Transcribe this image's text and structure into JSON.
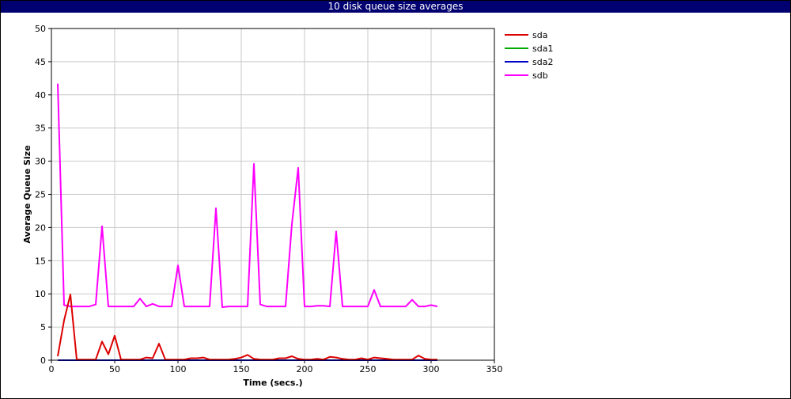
{
  "window": {
    "title": "10 disk queue size averages"
  },
  "chart_data": {
    "type": "line",
    "title": "10 disk queue size averages",
    "xlabel": "Time (secs.)",
    "ylabel": "Average Queue Size",
    "xlim": [
      0,
      350
    ],
    "ylim": [
      0,
      50
    ],
    "xticks": [
      0,
      50,
      100,
      150,
      200,
      250,
      300,
      350
    ],
    "yticks": [
      0,
      5,
      10,
      15,
      20,
      25,
      30,
      35,
      40,
      45,
      50
    ],
    "grid": true,
    "legend_position": "right",
    "series": [
      {
        "name": "sda",
        "color": "#dd0000",
        "points": [
          [
            5,
            0.6
          ],
          [
            10,
            6
          ],
          [
            15,
            9.9
          ],
          [
            20,
            0.1
          ],
          [
            25,
            0.1
          ],
          [
            30,
            0.1
          ],
          [
            35,
            0.1
          ],
          [
            40,
            2.8
          ],
          [
            45,
            0.9
          ],
          [
            50,
            3.7
          ],
          [
            55,
            0.1
          ],
          [
            60,
            0.1
          ],
          [
            65,
            0.1
          ],
          [
            70,
            0.1
          ],
          [
            75,
            0.4
          ],
          [
            80,
            0.3
          ],
          [
            85,
            2.5
          ],
          [
            90,
            0.1
          ],
          [
            95,
            0.1
          ],
          [
            100,
            0.1
          ],
          [
            105,
            0.1
          ],
          [
            110,
            0.3
          ],
          [
            115,
            0.3
          ],
          [
            120,
            0.4
          ],
          [
            125,
            0.1
          ],
          [
            130,
            0.1
          ],
          [
            135,
            0.1
          ],
          [
            140,
            0.1
          ],
          [
            145,
            0.2
          ],
          [
            150,
            0.4
          ],
          [
            155,
            0.8
          ],
          [
            160,
            0.2
          ],
          [
            165,
            0.1
          ],
          [
            170,
            0.1
          ],
          [
            175,
            0.1
          ],
          [
            180,
            0.3
          ],
          [
            185,
            0.3
          ],
          [
            190,
            0.6
          ],
          [
            195,
            0.2
          ],
          [
            200,
            0.1
          ],
          [
            205,
            0.1
          ],
          [
            210,
            0.2
          ],
          [
            215,
            0.1
          ],
          [
            220,
            0.5
          ],
          [
            225,
            0.4
          ],
          [
            230,
            0.2
          ],
          [
            235,
            0.1
          ],
          [
            240,
            0.1
          ],
          [
            245,
            0.3
          ],
          [
            250,
            0.1
          ],
          [
            255,
            0.4
          ],
          [
            260,
            0.3
          ],
          [
            265,
            0.2
          ],
          [
            270,
            0.1
          ],
          [
            275,
            0.1
          ],
          [
            280,
            0.1
          ],
          [
            285,
            0.1
          ],
          [
            290,
            0.7
          ],
          [
            295,
            0.2
          ],
          [
            300,
            0.1
          ],
          [
            305,
            0.1
          ]
        ]
      },
      {
        "name": "sda1",
        "color": "#00aa00",
        "points": [
          [
            5,
            0
          ],
          [
            305,
            0
          ]
        ]
      },
      {
        "name": "sda2",
        "color": "#0000cc",
        "points": [
          [
            5,
            0
          ],
          [
            305,
            0
          ]
        ]
      },
      {
        "name": "sdb",
        "color": "#ff00ff",
        "points": [
          [
            5,
            41.7
          ],
          [
            10,
            8.3
          ],
          [
            15,
            8.1
          ],
          [
            20,
            8.1
          ],
          [
            25,
            8.1
          ],
          [
            30,
            8.1
          ],
          [
            35,
            8.4
          ],
          [
            40,
            20.2
          ],
          [
            45,
            8.1
          ],
          [
            50,
            8.1
          ],
          [
            55,
            8.1
          ],
          [
            60,
            8.1
          ],
          [
            65,
            8.1
          ],
          [
            70,
            9.3
          ],
          [
            75,
            8.1
          ],
          [
            80,
            8.5
          ],
          [
            85,
            8.1
          ],
          [
            90,
            8.1
          ],
          [
            95,
            8.1
          ],
          [
            100,
            14.3
          ],
          [
            105,
            8.1
          ],
          [
            110,
            8.1
          ],
          [
            115,
            8.1
          ],
          [
            120,
            8.1
          ],
          [
            125,
            8.1
          ],
          [
            130,
            22.9
          ],
          [
            135,
            8.0
          ],
          [
            140,
            8.1
          ],
          [
            145,
            8.1
          ],
          [
            150,
            8.1
          ],
          [
            155,
            8.1
          ],
          [
            160,
            29.6
          ],
          [
            165,
            8.4
          ],
          [
            170,
            8.1
          ],
          [
            175,
            8.1
          ],
          [
            180,
            8.1
          ],
          [
            185,
            8.1
          ],
          [
            190,
            20.5
          ],
          [
            195,
            29.0
          ],
          [
            200,
            8.1
          ],
          [
            205,
            8.1
          ],
          [
            210,
            8.2
          ],
          [
            215,
            8.2
          ],
          [
            220,
            8.1
          ],
          [
            225,
            19.4
          ],
          [
            230,
            8.1
          ],
          [
            235,
            8.1
          ],
          [
            240,
            8.1
          ],
          [
            245,
            8.1
          ],
          [
            250,
            8.1
          ],
          [
            255,
            10.6
          ],
          [
            260,
            8.1
          ],
          [
            265,
            8.1
          ],
          [
            270,
            8.1
          ],
          [
            275,
            8.1
          ],
          [
            280,
            8.1
          ],
          [
            285,
            9.1
          ],
          [
            290,
            8.1
          ],
          [
            295,
            8.1
          ],
          [
            300,
            8.3
          ],
          [
            305,
            8.1
          ]
        ]
      }
    ]
  }
}
